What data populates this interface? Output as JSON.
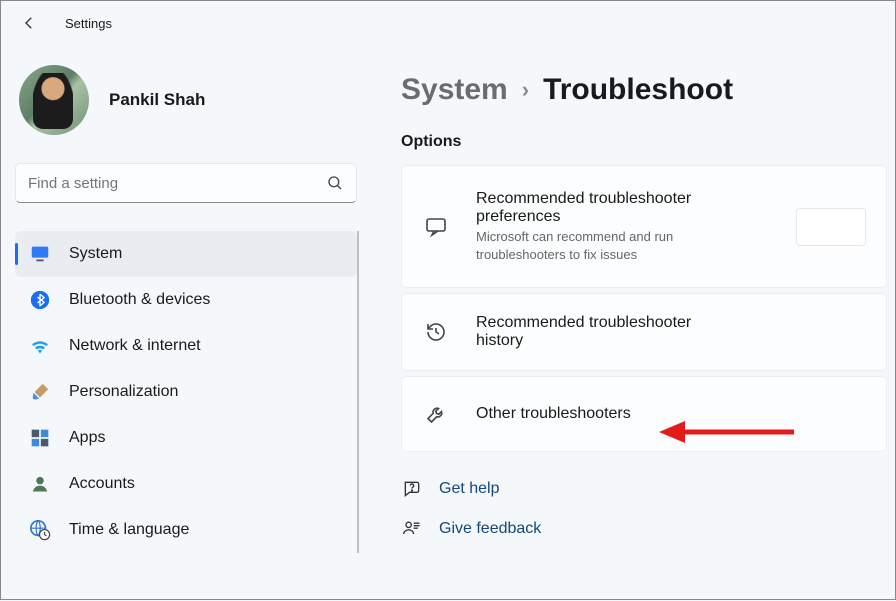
{
  "app": {
    "title": "Settings"
  },
  "user": {
    "name": "Pankil Shah"
  },
  "search": {
    "placeholder": "Find a setting"
  },
  "sidebar": {
    "items": [
      {
        "label": "System",
        "icon": "monitor",
        "active": true
      },
      {
        "label": "Bluetooth & devices",
        "icon": "bluetooth",
        "active": false
      },
      {
        "label": "Network & internet",
        "icon": "wifi",
        "active": false
      },
      {
        "label": "Personalization",
        "icon": "brush",
        "active": false
      },
      {
        "label": "Apps",
        "icon": "grid",
        "active": false
      },
      {
        "label": "Accounts",
        "icon": "person",
        "active": false
      },
      {
        "label": "Time & language",
        "icon": "globe-clock",
        "active": false
      }
    ]
  },
  "breadcrumb": {
    "parent": "System",
    "sep": "›",
    "current": "Troubleshoot"
  },
  "sections": {
    "options_title": "Options"
  },
  "tiles": [
    {
      "icon": "chat-bubble",
      "title": "Recommended troubleshooter preferences",
      "desc": "Microsoft can recommend and run troubleshooters to fix issues",
      "has_control": true
    },
    {
      "icon": "history",
      "title": "Recommended troubleshooter history",
      "desc": "",
      "has_control": false
    },
    {
      "icon": "wrench",
      "title": "Other troubleshooters",
      "desc": "",
      "has_control": false,
      "highlighted": true
    }
  ],
  "links": [
    {
      "icon": "help",
      "label": "Get help"
    },
    {
      "icon": "feedback",
      "label": "Give feedback"
    }
  ],
  "colors": {
    "accent": "#1b6ef3",
    "link": "#15477a"
  }
}
